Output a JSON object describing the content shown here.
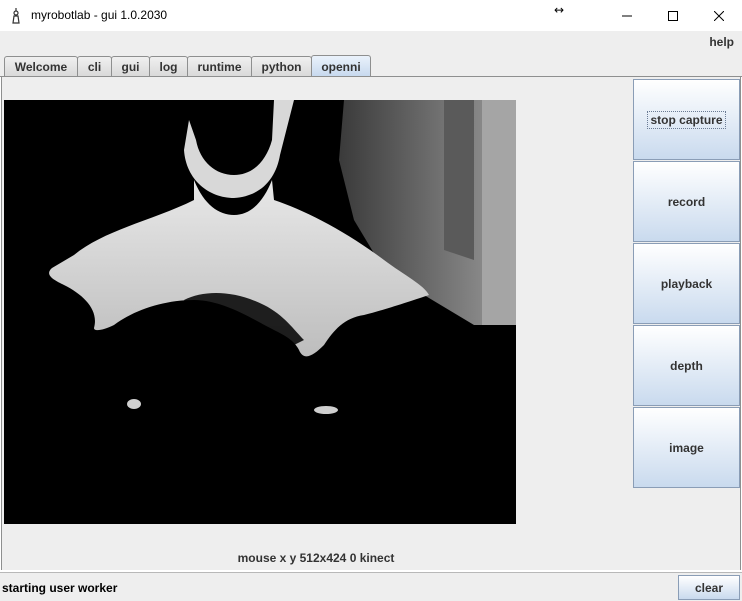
{
  "window": {
    "title": "myrobotlab - gui 1.0.2030",
    "controls": {
      "minimize": "minimize-icon",
      "maximize": "maximize-icon",
      "close": "close-icon"
    }
  },
  "menu": {
    "help": "help"
  },
  "tabs": [
    {
      "label": "Welcome",
      "active": false
    },
    {
      "label": "cli",
      "active": false
    },
    {
      "label": "gui",
      "active": false
    },
    {
      "label": "log",
      "active": false
    },
    {
      "label": "runtime",
      "active": false
    },
    {
      "label": "python",
      "active": false
    },
    {
      "label": "openni",
      "active": true
    }
  ],
  "openni": {
    "buttons": {
      "stop_capture": "stop capture",
      "record": "record",
      "playback": "playback",
      "depth": "depth",
      "image": "image"
    },
    "info_line": "mouse x y  512x424  0  kinect"
  },
  "status": {
    "log": "starting user worker",
    "clear": "clear"
  },
  "colors": {
    "tab_active": "#c6d8ee",
    "button_gradient_bottom": "#c9daee",
    "panel_bg": "#eeeeee"
  }
}
